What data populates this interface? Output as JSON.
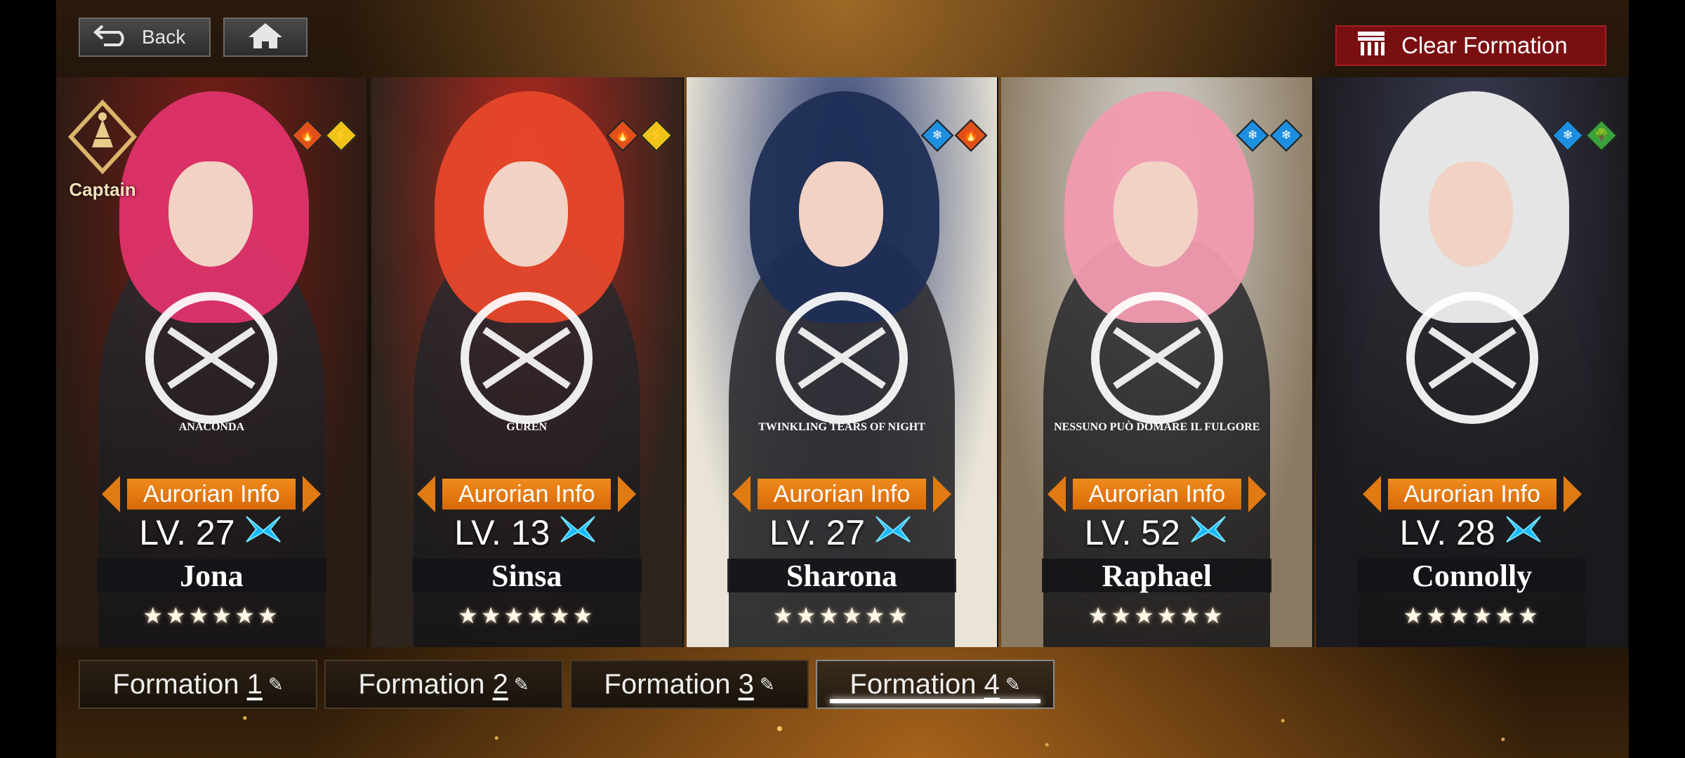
{
  "topbar": {
    "back_label": "Back",
    "clear_label": "Clear Formation"
  },
  "captain_label": "Captain",
  "cards": [
    {
      "name": "Jona",
      "level": "LV. 27",
      "info_label": "Aurorian Info",
      "stars": "★★★★★★",
      "elements": [
        "fire",
        "thunder"
      ],
      "emblem_text": "ANACONDA",
      "colors": {
        "hair": "#e0336a",
        "bg1": "#7a1e16",
        "bg2": "#2a1b14"
      }
    },
    {
      "name": "Sinsa",
      "level": "LV. 13",
      "info_label": "Aurorian Info",
      "stars": "★★★★★★",
      "elements": [
        "fire",
        "thunder"
      ],
      "emblem_text": "GUREN",
      "colors": {
        "hair": "#e8472a",
        "bg1": "#b6281e",
        "bg2": "#2c241d"
      }
    },
    {
      "name": "Sharona",
      "level": "LV. 27",
      "info_label": "Aurorian Info",
      "stars": "★★★★★★",
      "elements": [
        "ice",
        "fire"
      ],
      "emblem_text": "TWINKLING TEARS OF NIGHT",
      "colors": {
        "hair": "#1f2e55",
        "bg1": "#2a3a72",
        "bg2": "#e9e4d5"
      }
    },
    {
      "name": "Raphael",
      "level": "LV. 52",
      "info_label": "Aurorian Info",
      "stars": "★★★★★★",
      "elements": [
        "ice",
        "ice"
      ],
      "emblem_text": "NESSUNO PUÒ DOMARE IL FULGORE",
      "colors": {
        "hair": "#f29ab0",
        "bg1": "#d8d6d2",
        "bg2": "#8a7a62"
      }
    },
    {
      "name": "Connolly",
      "level": "LV. 28",
      "info_label": "Aurorian Info",
      "stars": "★★★★★★",
      "elements": [
        "ice",
        "nature"
      ],
      "emblem_text": "",
      "colors": {
        "hair": "#efefef",
        "bg1": "#3a3c52",
        "bg2": "#1a1a1e"
      }
    }
  ],
  "formations": [
    {
      "prefix": "Formation ",
      "num": "1",
      "active": false
    },
    {
      "prefix": "Formation ",
      "num": "2",
      "active": false
    },
    {
      "prefix": "Formation ",
      "num": "3",
      "active": false
    },
    {
      "prefix": "Formation ",
      "num": "4",
      "active": true
    }
  ],
  "element_colors": {
    "fire": "#e2501a",
    "thunder": "#f0c419",
    "ice": "#1d8fe0",
    "nature": "#3aa23a"
  }
}
